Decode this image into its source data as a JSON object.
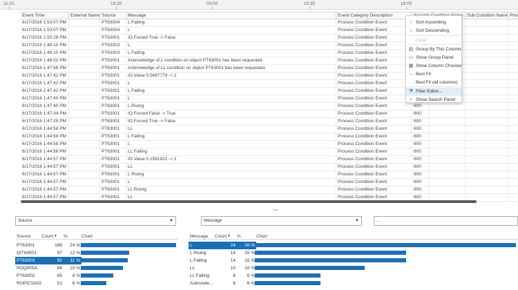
{
  "timeline": {
    "ticks": [
      "11:02",
      "19:35",
      "03:05",
      "10:35",
      "18:05"
    ]
  },
  "grid": {
    "columns": [
      "Event Time",
      "External Name",
      "Source",
      "Message",
      "Event Category Description",
      "Severity",
      "Condition Name",
      "Sub Condition Name",
      "Process Section"
    ],
    "rows": [
      {
        "time": "6/17/2016 1:53:07 PM",
        "source": "PT63004",
        "message": "L Falling",
        "category": "Process Condition Event",
        "severity": ""
      },
      {
        "time": "6/17/2016 1:53:07 PM",
        "source": "PT63004",
        "message": "L",
        "category": "Process Condition Event",
        "severity": ""
      },
      {
        "time": "6/17/2016 1:50:28 PM",
        "source": "PT63001",
        "message": "IO.Forced True -> False",
        "category": "Process Condition Event",
        "severity": ""
      },
      {
        "time": "6/17/2016 1:48:10 PM",
        "source": "PT63003",
        "message": "L",
        "category": "Process Condition Event",
        "severity": ""
      },
      {
        "time": "6/17/2016 1:48:10 PM",
        "source": "PT63003",
        "message": "L Falling",
        "category": "Process Condition Event",
        "severity": ""
      },
      {
        "time": "6/17/2016 1:48:02 PM",
        "source": "PT63001",
        "message": "Acknowledge of L condition on object PT63001 has been requested.",
        "category": "Process Condition Event",
        "severity": ""
      },
      {
        "time": "6/17/2016 1:47:58 PM",
        "source": "PT63001",
        "message": "Acknowledge of LL condition on object PT63001 has been requested.",
        "category": "Process Condition Event",
        "severity": ""
      },
      {
        "time": "6/17/2016 1:47:42 PM",
        "source": "PT63001",
        "message": "IO.Value 0.5687779 -> 2",
        "category": "Process Condition Event",
        "severity": ""
      },
      {
        "time": "6/17/2016 1:47:42 PM",
        "source": "PT63001",
        "message": "L",
        "category": "Process Condition Event",
        "severity": ""
      },
      {
        "time": "6/17/2016 1:47:42 PM",
        "source": "PT63001",
        "message": "L Falling",
        "category": "Process Condition Event",
        "severity": "600"
      },
      {
        "time": "6/17/2016 1:47:40 PM",
        "source": "PT63001",
        "message": "L",
        "category": "Process Condition Event",
        "severity": "600"
      },
      {
        "time": "6/17/2016 1:47:40 PM",
        "source": "PT63001",
        "message": "L Rising",
        "category": "Process Condition Event",
        "severity": "600"
      },
      {
        "time": "6/17/2016 1:47:34 PM",
        "source": "PT63001",
        "message": "IO.Forced False -> True",
        "category": "Process Condition Event",
        "severity": "600"
      },
      {
        "time": "6/17/2016 1:47:29 PM",
        "source": "PT63001",
        "message": "IO.Forced True -> False",
        "category": "Process Condition Event",
        "severity": "600"
      },
      {
        "time": "6/17/2016 1:44:58 PM",
        "source": "PT63001",
        "message": "LL",
        "category": "Process Condition Event",
        "severity": "600"
      },
      {
        "time": "6/17/2016 1:44:58 PM",
        "source": "PT63001",
        "message": "L Falling",
        "category": "Process Condition Event",
        "severity": "600"
      },
      {
        "time": "6/17/2016 1:44:58 PM",
        "source": "PT63001",
        "message": "L",
        "category": "Process Condition Event",
        "severity": "600"
      },
      {
        "time": "6/17/2016 1:44:58 PM",
        "source": "PT63001",
        "message": "LL Falling",
        "category": "Process Condition Event",
        "severity": "600"
      },
      {
        "time": "6/17/2016 1:44:57 PM",
        "source": "PT63001",
        "message": "IO.Value 0.1591922 -> 2",
        "category": "Process Condition Event",
        "severity": "600"
      },
      {
        "time": "6/17/2016 1:44:57 PM",
        "source": "PT63001",
        "message": "LL",
        "category": "Process Condition Event",
        "severity": "600"
      },
      {
        "time": "6/17/2016 1:44:57 PM",
        "source": "PT63001",
        "message": "L Rising",
        "category": "Process Condition Event",
        "severity": "600"
      },
      {
        "time": "6/17/2016 1:44:57 PM",
        "source": "PT63001",
        "message": "L",
        "category": "Process Condition Event",
        "severity": "600"
      },
      {
        "time": "6/17/2016 1:44:57 PM",
        "source": "PT63001",
        "message": "LL Rising",
        "category": "Process Condition Event",
        "severity": "600"
      },
      {
        "time": "6/17/2016 1:44:57 PM",
        "source": "PT63001",
        "message": "LL",
        "category": "Process Condition Event",
        "severity": "600"
      }
    ]
  },
  "context_menu": {
    "items": [
      {
        "label": "Sort Ascending",
        "icon": "sort-ascending-icon",
        "glyph": "↑",
        "disabled": false,
        "highlighted": false
      },
      {
        "label": "Sort Descending",
        "icon": "sort-descending-icon",
        "glyph": "↓",
        "disabled": false,
        "highlighted": false
      },
      {
        "label": "Clear",
        "icon": "",
        "glyph": "",
        "disabled": true,
        "highlighted": false
      },
      {
        "label": "Group By This Column",
        "icon": "group-by-icon",
        "glyph": "▤",
        "disabled": false,
        "highlighted": false
      },
      {
        "label": "Show Group Panel",
        "icon": "group-panel-icon",
        "glyph": "▭",
        "disabled": false,
        "highlighted": false
      },
      {
        "label": "Show Column Chooser",
        "icon": "column-chooser-icon",
        "glyph": "▦",
        "disabled": false,
        "highlighted": false
      },
      {
        "label": "Best Fit",
        "icon": "best-fit-icon",
        "glyph": "↔",
        "disabled": false,
        "highlighted": false
      },
      {
        "label": "Best Fit (all columns)",
        "icon": "",
        "glyph": "",
        "disabled": false,
        "highlighted": false
      },
      {
        "label": "Filter Editor...",
        "icon": "filter-icon",
        "glyph": "⧩",
        "disabled": false,
        "highlighted": true
      },
      {
        "label": "Show Search Panel",
        "icon": "search-panel-icon",
        "glyph": "⌕",
        "disabled": false,
        "highlighted": false
      }
    ]
  },
  "panels": {
    "left": {
      "selector": "Source",
      "headers": [
        "Source",
        "Count",
        "%",
        "Chart"
      ],
      "rows": [
        {
          "name": "PT63001",
          "count": "189",
          "pct": "24 %",
          "fraction": 1.0,
          "selected": false
        },
        {
          "name": "QIT63001",
          "count": "97",
          "pct": "12 %",
          "fraction": 0.51,
          "selected": false
        },
        {
          "name": "PT63003",
          "count": "92",
          "pct": "11 %",
          "fraction": 0.49,
          "selected": true
        },
        {
          "name": "ROQIRSA",
          "count": "84",
          "pct": "10 %",
          "fraction": 0.44,
          "selected": false
        },
        {
          "name": "PT63002",
          "count": "65",
          "pct": "8 %",
          "fraction": 0.34,
          "selected": false
        },
        {
          "name": "ROPICSA02",
          "count": "51",
          "pct": "6 %",
          "fraction": 0.27,
          "selected": false
        }
      ]
    },
    "right": {
      "selector": "Message",
      "headers": [
        "Message",
        "Count",
        "%",
        "Chart"
      ],
      "rows": [
        {
          "name": "L",
          "count": "24",
          "pct": "26 %",
          "fraction": 1.0,
          "selected": true
        },
        {
          "name": "L Rising",
          "count": "14",
          "pct": "15 %",
          "fraction": 0.58,
          "selected": false
        },
        {
          "name": "L Falling",
          "count": "14",
          "pct": "15 %",
          "fraction": 0.58,
          "selected": false
        },
        {
          "name": "LL",
          "count": "10",
          "pct": "10 %",
          "fraction": 0.42,
          "selected": false
        },
        {
          "name": "LL Falling",
          "count": "6",
          "pct": "6 %",
          "fraction": 0.25,
          "selected": false
        },
        {
          "name": "Acknowle...",
          "count": "6",
          "pct": "6 %",
          "fraction": 0.25,
          "selected": false
        }
      ]
    },
    "third_selector": "..."
  },
  "colors": {
    "accent": "#1a6fb5",
    "bar": "#1f6fb2",
    "menu_highlight": "#e3edf7"
  }
}
